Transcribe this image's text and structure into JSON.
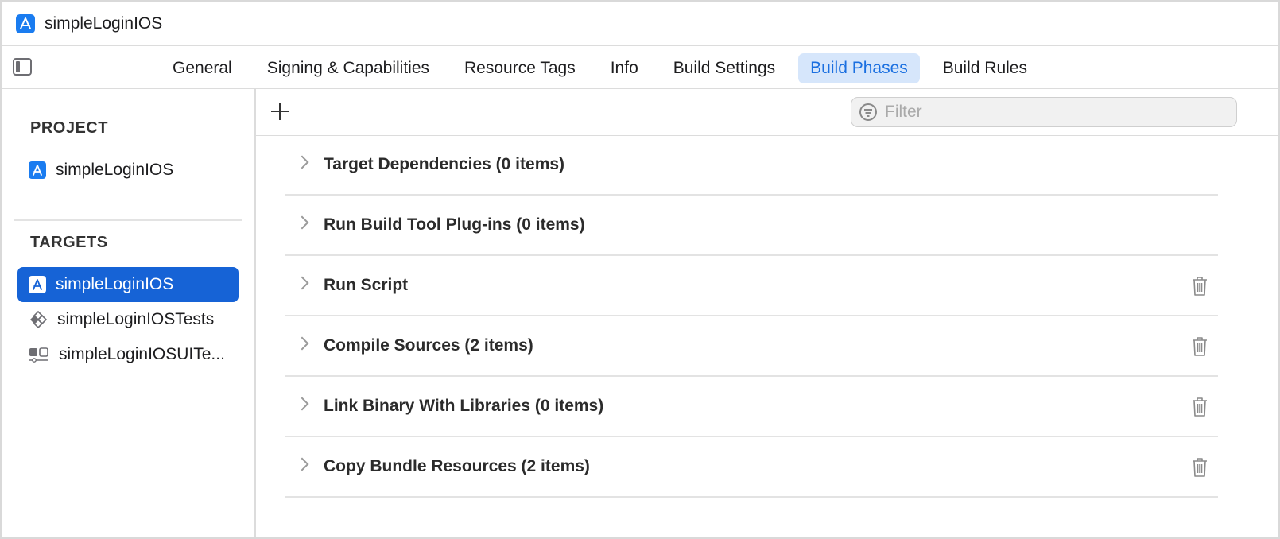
{
  "window": {
    "title": "simpleLoginIOS",
    "icon": "xcode-app-icon"
  },
  "tabs": [
    {
      "label": "General",
      "active": false
    },
    {
      "label": "Signing & Capabilities",
      "active": false
    },
    {
      "label": "Resource Tags",
      "active": false
    },
    {
      "label": "Info",
      "active": false
    },
    {
      "label": "Build Settings",
      "active": false
    },
    {
      "label": "Build Phases",
      "active": true
    },
    {
      "label": "Build Rules",
      "active": false
    }
  ],
  "sidebar": {
    "project_header": "PROJECT",
    "project": {
      "label": "simpleLoginIOS",
      "icon": "app-icon"
    },
    "targets_header": "TARGETS",
    "targets": [
      {
        "label": "simpleLoginIOS",
        "icon": "app-icon",
        "selected": true
      },
      {
        "label": "simpleLoginIOSTests",
        "icon": "unit-test-icon",
        "selected": false
      },
      {
        "label": "simpleLoginIOSUITe...",
        "icon": "ui-test-icon",
        "selected": false
      }
    ]
  },
  "toolbar": {
    "add_icon": "plus-icon",
    "filter_placeholder": "Filter",
    "filter_value": ""
  },
  "phases": [
    {
      "title": "Target Dependencies (0 items)",
      "deletable": false
    },
    {
      "title": "Run Build Tool Plug-ins (0 items)",
      "deletable": false
    },
    {
      "title": "Run Script",
      "deletable": true
    },
    {
      "title": "Compile Sources (2 items)",
      "deletable": true
    },
    {
      "title": "Link Binary With Libraries (0 items)",
      "deletable": true
    },
    {
      "title": "Copy Bundle Resources (2 items)",
      "deletable": true
    }
  ],
  "colors": {
    "accent": "#1a6fe0",
    "selection": "#1663d6",
    "active_tab_bg": "#d6e6fb"
  }
}
